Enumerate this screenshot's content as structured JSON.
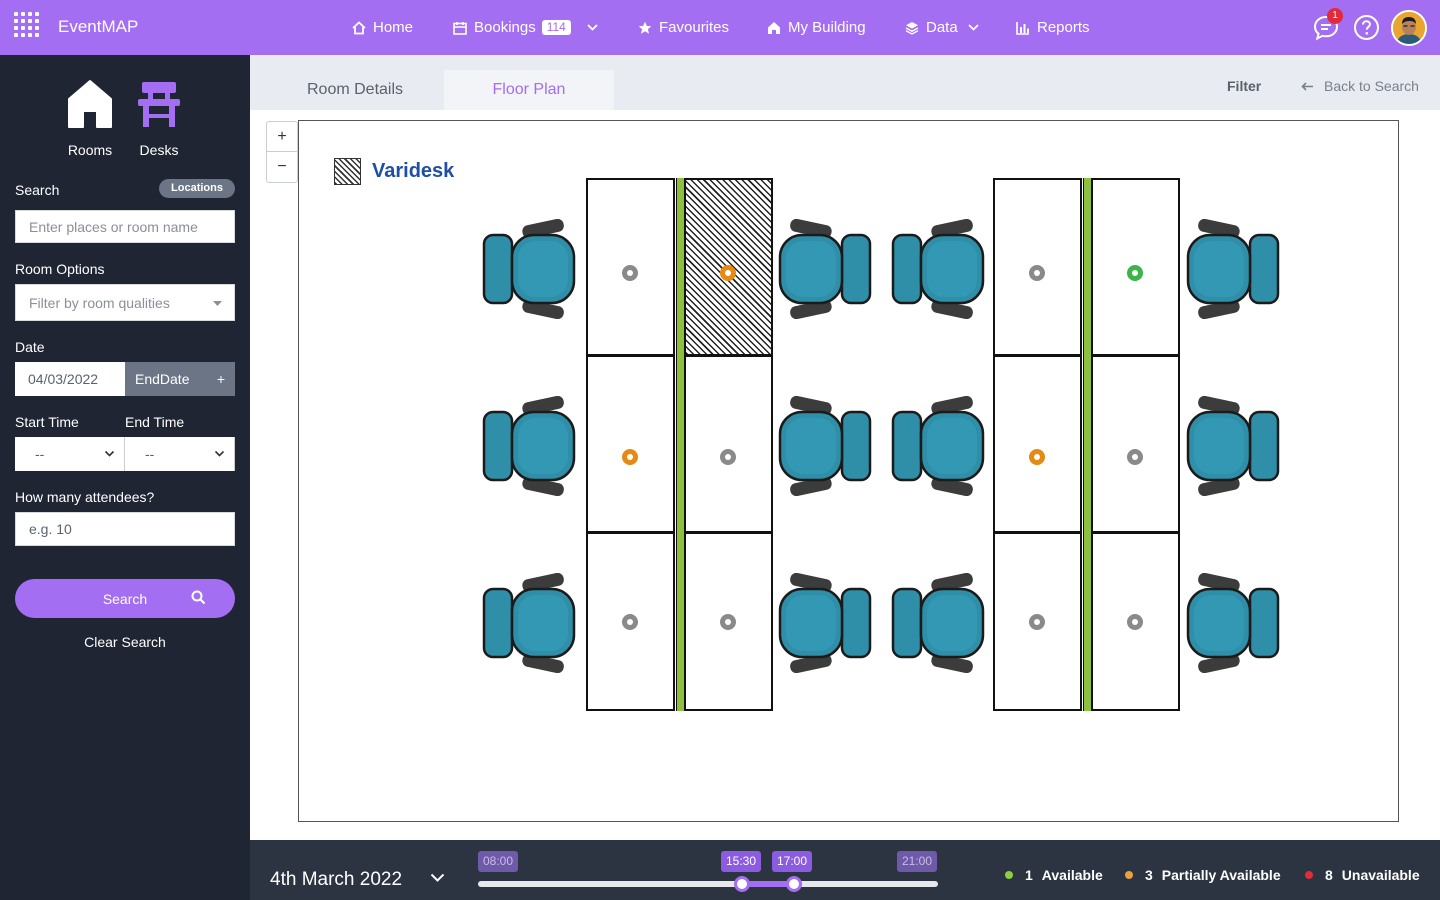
{
  "app": {
    "name": "EventMAP"
  },
  "nav": {
    "home": "Home",
    "bookings": "Bookings",
    "bookings_count": "114",
    "favourites": "Favourites",
    "my_building": "My Building",
    "data": "Data",
    "reports": "Reports",
    "notifications_count": "1"
  },
  "sidebar": {
    "rooms_label": "Rooms",
    "desks_label": "Desks",
    "search_label": "Search",
    "locations_pill": "Locations",
    "search_placeholder": "Enter places or room name",
    "room_options_label": "Room Options",
    "room_options_placeholder": "Filter by room qualities",
    "date_label": "Date",
    "date_value": "04/03/2022",
    "enddate_label": "EndDate",
    "enddate_plus": "+",
    "start_time_label": "Start Time",
    "end_time_label": "End Time",
    "start_time_value": "--",
    "end_time_value": "--",
    "attendees_label": "How many attendees?",
    "attendees_placeholder": "e.g. 10",
    "search_button": "Search",
    "clear_search": "Clear Search"
  },
  "tabs": {
    "room_details": "Room Details",
    "floor_plan": "Floor Plan",
    "filter": "Filter",
    "back_to_search": "Back to Search"
  },
  "map": {
    "zoom_in": "+",
    "zoom_out": "−",
    "legend_label": "Varidesk",
    "desks": [
      {
        "status": "unavailable",
        "hatched": false
      },
      {
        "status": "partial",
        "hatched": true
      },
      {
        "status": "unavailable",
        "hatched": false
      },
      {
        "status": "available",
        "hatched": false
      },
      {
        "status": "partial",
        "hatched": false
      },
      {
        "status": "unavailable",
        "hatched": false
      },
      {
        "status": "partial",
        "hatched": false
      },
      {
        "status": "unavailable",
        "hatched": false
      },
      {
        "status": "unavailable",
        "hatched": false
      },
      {
        "status": "unavailable",
        "hatched": false
      },
      {
        "status": "unavailable",
        "hatched": false
      },
      {
        "status": "unavailable",
        "hatched": false
      }
    ]
  },
  "status_colors": {
    "available": "#3bb54a",
    "partial": "#e58a12",
    "unavailable": "#8a8a8a",
    "unavailable_legend": "#e12b3b"
  },
  "bottom": {
    "date": "4th March 2022",
    "slider_min": "08:00",
    "slider_max": "21:00",
    "slider_start": "15:30",
    "slider_end": "17:00",
    "available_count": "1",
    "available_label": "Available",
    "partial_count": "3",
    "partial_label": "Partially Available",
    "unavailable_count": "8",
    "unavailable_label": "Unavailable"
  }
}
